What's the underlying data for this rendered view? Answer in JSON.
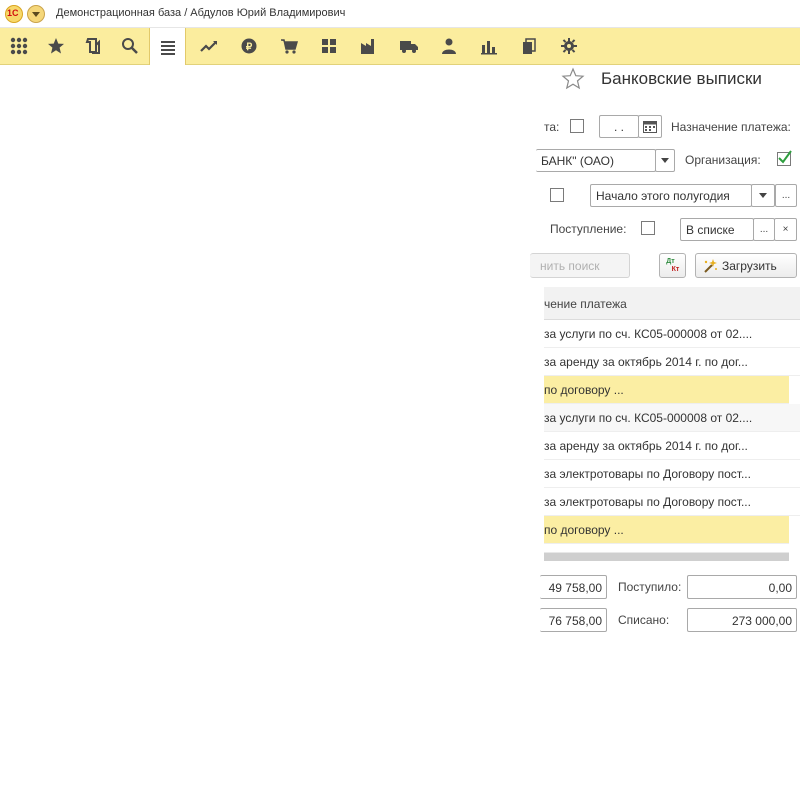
{
  "window": {
    "logo_text": "1С",
    "title": "Демонстрационная база / Абдулов Юрий Владимирович"
  },
  "toolbar": {
    "icons": [
      "apps-grid-icon",
      "favorites-star-icon",
      "history-icon",
      "search-icon",
      "main-menu-icon",
      "sales-chart-icon",
      "bank-cash-icon",
      "purchases-cart-icon",
      "warehouse-icon",
      "production-icon",
      "delivery-truck-icon",
      "employees-icon",
      "reports-icon",
      "directories-icon",
      "settings-gear-icon"
    ],
    "active": "main-menu-icon",
    "accent_color": "#fbed9e"
  },
  "form": {
    "title": "Банковские выписки",
    "filters": {
      "date_label": "та:",
      "date_value": " .  . ",
      "purpose_label": "Назначение платежа:",
      "bank_account_value": "БАНК\" (ОАО)",
      "organization_label": "Организация:",
      "organization_checked": true,
      "period_value": "Начало этого полугодия",
      "receipt_label": "Поступление:",
      "in_list_value": "В списке"
    },
    "buttons": {
      "clear_search": "нить поиск",
      "dt_kt_top": "Дт",
      "dt_kt_bottom": "Кт",
      "load": "Загрузить"
    },
    "table": {
      "header": "чение платежа",
      "rows": [
        {
          "text": "за услуги по сч. КС05-000008 от 02....",
          "type": "normal"
        },
        {
          "text": "за аренду за октябрь 2014 г. по дог...",
          "type": "normal"
        },
        {
          "text": "по договору ...",
          "type": "group"
        },
        {
          "text": "за услуги по сч. КС05-000008 от 02....",
          "type": "alt"
        },
        {
          "text": "за аренду за октябрь 2014 г. по дог...",
          "type": "normal"
        },
        {
          "text": "за электротовары по Договору пост...",
          "type": "normal"
        },
        {
          "text": "за электротовары по Договору пост...",
          "type": "normal"
        },
        {
          "text": "по договору ...",
          "type": "group"
        }
      ]
    },
    "totals": {
      "start_balance": "49 758,00",
      "end_balance": "76 758,00",
      "received_label": "Поступило:",
      "received_value": "0,00",
      "written_off_label": "Списано:",
      "written_off_value": "273 000,00"
    },
    "more_button": "...",
    "clear_button": "×"
  }
}
